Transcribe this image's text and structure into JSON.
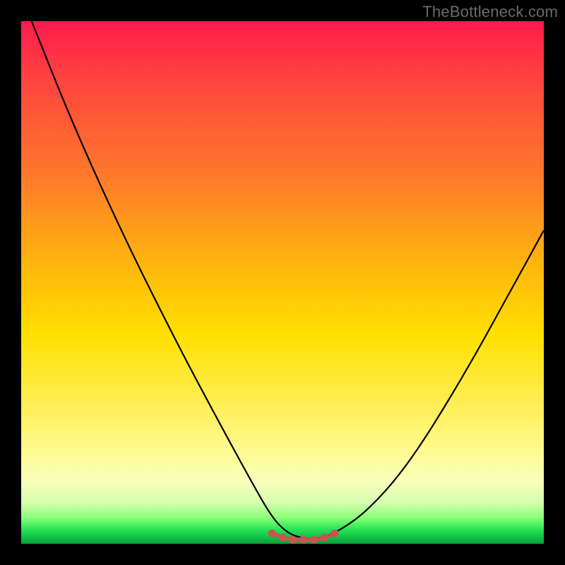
{
  "attribution": "TheBottleneck.com",
  "chart_data": {
    "type": "line",
    "title": "",
    "xlabel": "",
    "ylabel": "",
    "xlim": [
      0,
      100
    ],
    "ylim": [
      0,
      100
    ],
    "series": [
      {
        "name": "bottleneck-curve",
        "x": [
          2,
          10,
          20,
          30,
          38,
          44,
          48,
          51,
          54,
          57,
          60,
          66,
          74,
          84,
          94,
          100
        ],
        "values": [
          100,
          80,
          58,
          38,
          23,
          12,
          5,
          2,
          1,
          1,
          2,
          6,
          15,
          31,
          49,
          60
        ]
      },
      {
        "name": "bottleneck-minimum-markers",
        "x": [
          48,
          50,
          52,
          54,
          56,
          58,
          60
        ],
        "values": [
          2,
          1.2,
          0.8,
          0.8,
          0.8,
          1.2,
          2
        ]
      }
    ],
    "colors": {
      "curve": "#000000",
      "markers": "#c9544f",
      "gradient_top": "#ff1a4d",
      "gradient_bottom": "#0a9c3a"
    }
  }
}
